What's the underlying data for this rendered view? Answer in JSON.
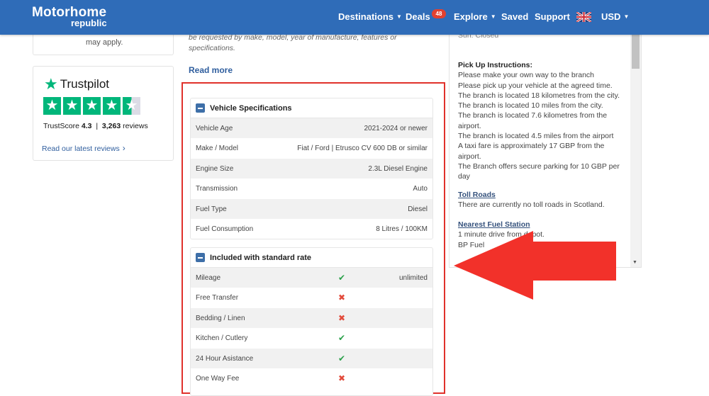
{
  "brand": {
    "name_line1": "Motorhome",
    "name_line2": "republic"
  },
  "nav": {
    "destinations": "Destinations",
    "deals": "Deals",
    "deals_badge": "48",
    "explore": "Explore",
    "saved": "Saved",
    "support": "Support",
    "currency": "USD"
  },
  "left": {
    "apply_text": "may apply.",
    "trustpilot": {
      "brand": "Trustpilot",
      "trustscore_label": "TrustScore",
      "trustscore_value": "4.3",
      "separator": "|",
      "reviews_count": "3,263",
      "reviews_label": "reviews",
      "latest_link": "Read our latest reviews",
      "rating_stars": 4.3,
      "accent": "#00b67a"
    }
  },
  "middle": {
    "intro_text": "be requested by make, model, year of manufacture, features or specifications.",
    "read_more": "Read more"
  },
  "vehicle_specs": {
    "title": "Vehicle Specifications",
    "rows": [
      {
        "label": "Vehicle Age",
        "value": "2021-2024 or newer"
      },
      {
        "label": "Make / Model",
        "value": "Fiat / Ford | Etrusco CV 600 DB or similar"
      },
      {
        "label": "Engine Size",
        "value": "2.3L Diesel Engine"
      },
      {
        "label": "Transmission",
        "value": "Auto"
      },
      {
        "label": "Fuel Type",
        "value": "Diesel"
      },
      {
        "label": "Fuel Consumption",
        "value": "8 Litres / 100KM"
      }
    ]
  },
  "included": {
    "title": "Included with standard rate",
    "rows": [
      {
        "label": "Mileage",
        "included": true,
        "value": "unlimited"
      },
      {
        "label": "Free Transfer",
        "included": false,
        "value": ""
      },
      {
        "label": "Bedding / Linen",
        "included": false,
        "value": ""
      },
      {
        "label": "Kitchen / Cutlery",
        "included": true,
        "value": ""
      },
      {
        "label": "24 Hour Asistance",
        "included": true,
        "value": ""
      },
      {
        "label": "One Way Fee",
        "included": false,
        "value": ""
      }
    ]
  },
  "right_panel": {
    "top_text": "Sun: Closed",
    "pickup_title": "Pick Up Instructions:",
    "pickup_lines": [
      "Please make your own way to the branch",
      "Please pick up your vehicle at the agreed time.",
      "The branch is located 18 kilometres from the city.",
      "The branch is located 10 miles from the city.",
      "The branch is located 7.6 kilometres from the airport.",
      "The branch is located 4.5 miles from the airport",
      "A taxi fare is approximately 17 GBP from the airport.",
      "The Branch offers secure parking for 10 GBP per day"
    ],
    "toll_title": "Toll Roads",
    "toll_text": "There are currently no toll roads in Scotland.",
    "fuel_title": "Nearest Fuel Station",
    "fuel_line1": "1 minute drive from depot.",
    "fuel_line2": "BP Fuel"
  },
  "colors": {
    "nav_bg": "#2f6cb8",
    "highlight_red": "#e0312b",
    "check_green": "#2aa04a",
    "cross_red": "#e24b3b"
  }
}
